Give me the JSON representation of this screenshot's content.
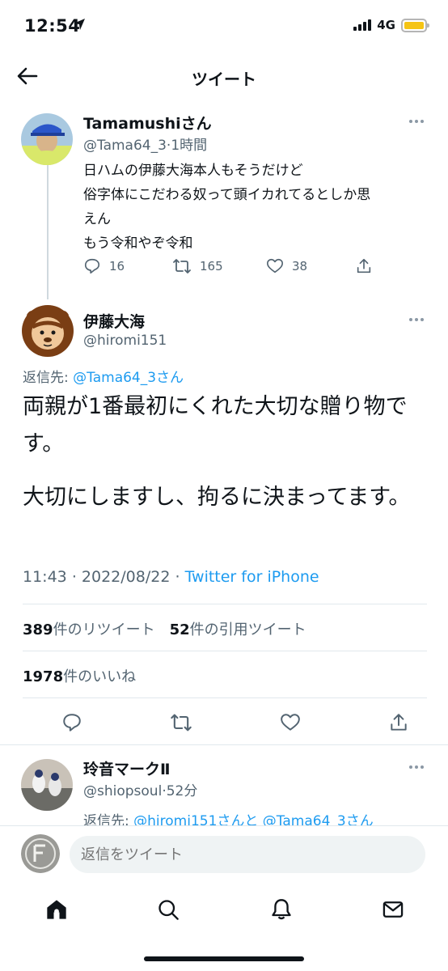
{
  "status": {
    "time": "12:54",
    "network": "4G"
  },
  "nav": {
    "title": "ツイート"
  },
  "parent_tweet": {
    "name": "Tamamushiさん",
    "handle": "@Tama64_3",
    "time": "1時間",
    "text_lines": [
      "日ハムの伊藤大海本人もそうだけど",
      "俗字体にこだわる奴って頭イカれてるとしか思",
      "えん",
      "もう令和やぞ令和"
    ],
    "replies": "16",
    "retweets": "165",
    "likes": "38"
  },
  "main_tweet": {
    "name": "伊藤大海",
    "handle": "@hiromi151",
    "reply_label": "返信先:",
    "reply_target": "@Tama64_3さん",
    "text_para1": "両親が1番最初にくれた大切な贈り物です。",
    "text_para2": "大切にしますし、拘るに決まってます。",
    "time": "11:43",
    "date": "2022/08/22",
    "source": "Twitter for iPhone",
    "retweet_count": "389",
    "retweet_label": "件のリツイート",
    "quote_count": "52",
    "quote_label": "件の引用ツイート",
    "like_count": "1978",
    "like_label": "件のいいね"
  },
  "reply_tweet": {
    "name": "玲音マークⅡ",
    "handle": "@shiopsoul",
    "time": "52分",
    "reply_label": "返信先:",
    "reply_target_1": "@hiromi151さんと",
    "reply_target_2": "@Tama64_3さん"
  },
  "composer": {
    "placeholder": "返信をツイート"
  },
  "icons": [
    "back-arrow-icon",
    "more-icon",
    "reply-icon",
    "retweet-icon",
    "like-icon",
    "share-icon",
    "home-icon",
    "search-icon",
    "notifications-icon",
    "messages-icon"
  ],
  "colors": {
    "accent": "#1d9bf0",
    "text": "#0f1419",
    "secondary": "#536471",
    "battery": "#f5c414"
  }
}
